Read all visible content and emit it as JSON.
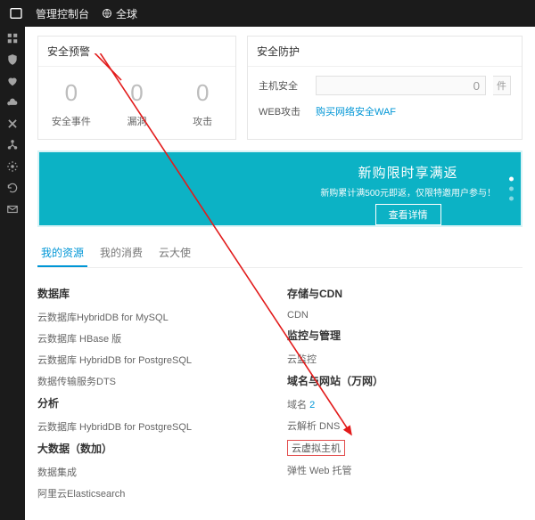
{
  "topbar": {
    "console_label": "管理控制台",
    "region_label": "全球"
  },
  "cards": {
    "alert": {
      "title": "安全预警",
      "cols": [
        {
          "value": "0",
          "label": "安全事件"
        },
        {
          "value": "0",
          "label": "漏洞"
        },
        {
          "value": "0",
          "label": "攻击"
        }
      ]
    },
    "protect": {
      "title": "安全防护",
      "host_label": "主机安全",
      "host_value": "0",
      "host_unit": "件",
      "web_label": "WEB攻击",
      "web_link": "购买网络安全WAF"
    }
  },
  "promo": {
    "title": "新购限时享满返",
    "sub": "新购累计满500元即返，仅限特邀用户参与！",
    "btn": "查看详情"
  },
  "tabs": [
    {
      "label": "我的资源",
      "active": true
    },
    {
      "label": "我的消费",
      "active": false
    },
    {
      "label": "云大使",
      "active": false
    }
  ],
  "resources": {
    "left": [
      {
        "head": "数据库",
        "items": [
          "云数据库HybridDB for MySQL",
          "云数据库 HBase 版",
          "云数据库 HybridDB for PostgreSQL",
          "数据传输服务DTS"
        ]
      },
      {
        "head": "分析",
        "items": [
          "云数据库 HybridDB for PostgreSQL"
        ]
      },
      {
        "head": "大数据（数加）",
        "items": [
          "数据集成",
          "阿里云Elasticsearch"
        ]
      }
    ],
    "right": [
      {
        "head": "存储与CDN",
        "items": [
          {
            "text": "CDN"
          }
        ]
      },
      {
        "head": "监控与管理",
        "items": [
          {
            "text": "云监控"
          }
        ]
      },
      {
        "head": "域名与网站（万网）",
        "items": [
          {
            "text": "域名",
            "badge": "2"
          },
          {
            "text": "云解析 DNS"
          },
          {
            "text": "云虚拟主机",
            "highlight": true
          },
          {
            "text": "弹性 Web 托管"
          }
        ]
      }
    ]
  }
}
